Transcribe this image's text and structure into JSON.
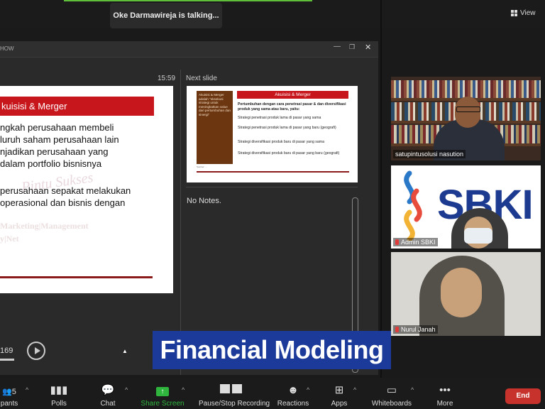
{
  "top": {
    "talking": "Oke Darmawireja is talking...",
    "view_label": "View"
  },
  "presenter": {
    "window_title": "HOW",
    "timer": "15:59",
    "next_slide_label": "Next slide",
    "notes": "No Notes.",
    "slide_number": "169"
  },
  "current_slide": {
    "title": "kuisisi & Merger",
    "lines": [
      "ngkah perusahaan membeli",
      "luruh saham perusahaan lain",
      "njadikan perusahaan yang",
      "dalam portfolio bisnisnya",
      "perusahaan sepakat melakukan",
      " operasional dan bisnis dengan"
    ],
    "watermark1": "Pintu Sukses",
    "watermark2": "Marketing|Management",
    "watermark3": "y|Net"
  },
  "next_slide": {
    "box_text": "Akuisisi & Merger adalah \"eksekusi strategi untuk meningkatkan value dari pertumbuhan dan sinergi\"",
    "header": "Akuisisi & Merger",
    "intro": "Pertumbuhan dengan cara penetrasi pasar & dan diversifikasi produk yang sama atau baru, yaitu:",
    "bullets": [
      "Strategi penetrasi produk lama di pasar yang sama",
      "Strategi penetrasi produk lama di pasar yang baru (geografi)",
      "Strategi diversifikasi produk baru di pasar yang sama",
      "Strategi diversifikasi produk baru di pasar yang baru (geografi)"
    ],
    "footnote": "Sumber: ..."
  },
  "participants": [
    {
      "name": "satupintusolusi nasution"
    },
    {
      "name": "Admin SBKI",
      "logo_text": "SBKI"
    },
    {
      "name": "Nurul Janah"
    }
  ],
  "caption": "Financial Modeling",
  "toolbar": {
    "participants_count": "5",
    "participants_label": "pants",
    "polls": "Polls",
    "chat": "Chat",
    "share": "Share Screen",
    "record": "Pause/Stop Recording",
    "reactions": "Reactions",
    "apps": "Apps",
    "whiteboards": "Whiteboards",
    "more": "More",
    "end": "End"
  },
  "colors": {
    "slide_red": "#c8161d",
    "share_green": "#2fb53e",
    "caption_blue": "#1b3a99",
    "end_red": "#c7332c",
    "sbki_blue": "#1c3a8f"
  }
}
